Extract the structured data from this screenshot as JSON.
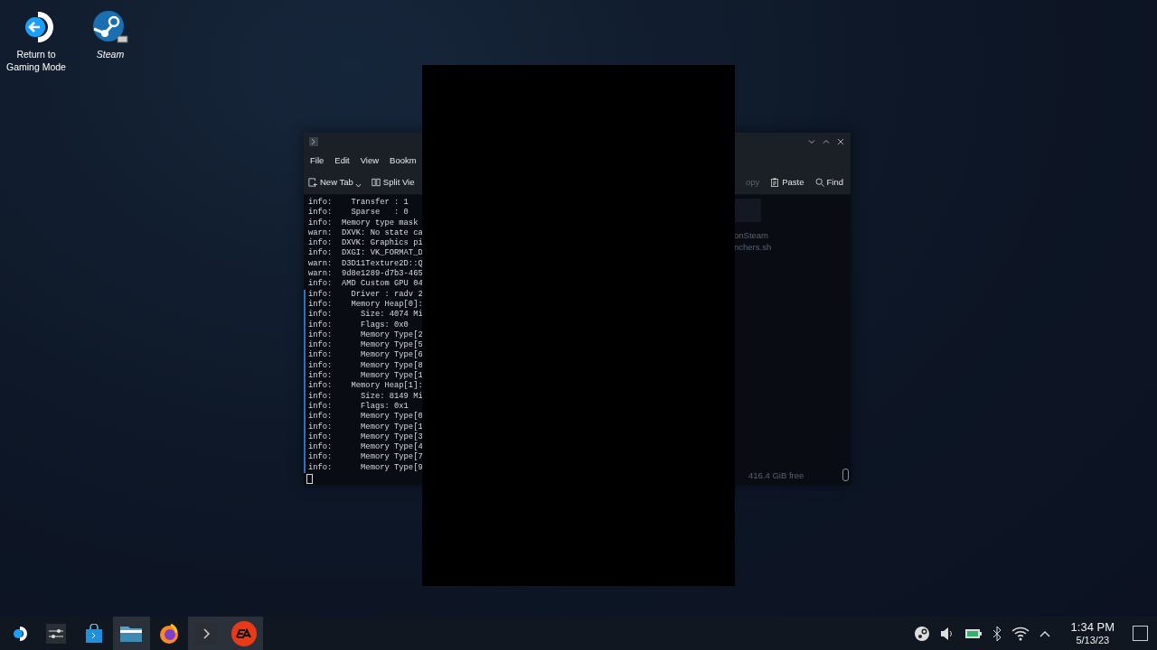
{
  "desktop_icons": [
    {
      "kind": "return",
      "label": "Return to Gaming Mode"
    },
    {
      "kind": "steam",
      "label": "Steam"
    }
  ],
  "terminal_window": {
    "menu": [
      "File",
      "Edit",
      "View",
      "Bookm"
    ],
    "toolbar_left": [
      {
        "kind": "new-tab",
        "label": "New Tab"
      },
      {
        "kind": "split",
        "label": "Split Vie"
      }
    ],
    "toolbar_right": [
      {
        "kind": "plain",
        "label": "opy"
      },
      {
        "kind": "paste",
        "label": "Paste"
      },
      {
        "kind": "find",
        "label": "Find"
      }
    ],
    "lines": [
      {
        "text": "info:    Transfer : 1",
        "marked": false
      },
      {
        "text": "info:    Sparse   : 0",
        "marked": false
      },
      {
        "text": "info:  Memory type mask",
        "marked": false
      },
      {
        "text": "warn:  DXVK: No state ca",
        "marked": false
      },
      {
        "text": "info:  DXVK: Graphics pi",
        "marked": false
      },
      {
        "text": "info:  DXGI: VK_FORMAT_D",
        "marked": false
      },
      {
        "text": "warn:  D3D11Texture2D::Q",
        "marked": false
      },
      {
        "text": "warn:  9d8e1289-d7b3-465",
        "marked": false
      },
      {
        "text": "info:  AMD Custom GPU 04",
        "marked": false
      },
      {
        "text": "info:    Driver : radv 2",
        "marked": true
      },
      {
        "text": "info:    Memory Heap[0]:",
        "marked": true
      },
      {
        "text": "info:      Size: 4074 Mi",
        "marked": true
      },
      {
        "text": "info:      Flags: 0x0",
        "marked": true
      },
      {
        "text": "info:      Memory Type[2",
        "marked": true
      },
      {
        "text": "info:      Memory Type[5",
        "marked": true
      },
      {
        "text": "info:      Memory Type[6",
        "marked": true
      },
      {
        "text": "info:      Memory Type[8",
        "marked": true
      },
      {
        "text": "info:      Memory Type[1",
        "marked": true
      },
      {
        "text": "info:    Memory Heap[1]:",
        "marked": true
      },
      {
        "text": "info:      Size: 8149 Mi",
        "marked": true
      },
      {
        "text": "info:      Flags: 0x1",
        "marked": true
      },
      {
        "text": "info:      Memory Type[0",
        "marked": true
      },
      {
        "text": "info:      Memory Type[1",
        "marked": true
      },
      {
        "text": "info:      Memory Type[3",
        "marked": true
      },
      {
        "text": "info:      Memory Type[4",
        "marked": true
      },
      {
        "text": "info:      Memory Type[7",
        "marked": true
      },
      {
        "text": "info:      Memory Type[9",
        "marked": true
      }
    ],
    "background_files": [
      "onSteam",
      "nchers.sh"
    ],
    "free_space": "416.4 GiB free"
  },
  "taskbar": {
    "apps": [
      {
        "kind": "launcher",
        "active": false
      },
      {
        "kind": "settings",
        "active": false
      },
      {
        "kind": "store",
        "active": false
      },
      {
        "kind": "files",
        "active": true
      },
      {
        "kind": "browser",
        "active": false
      },
      {
        "kind": "terminal",
        "active": true
      },
      {
        "kind": "ea",
        "active": true
      }
    ],
    "tray": [
      {
        "kind": "steam"
      },
      {
        "kind": "volume"
      },
      {
        "kind": "battery"
      },
      {
        "kind": "bluetooth"
      },
      {
        "kind": "wifi"
      },
      {
        "kind": "expand"
      }
    ],
    "time": "1:34 PM",
    "date": "5/13/23"
  }
}
